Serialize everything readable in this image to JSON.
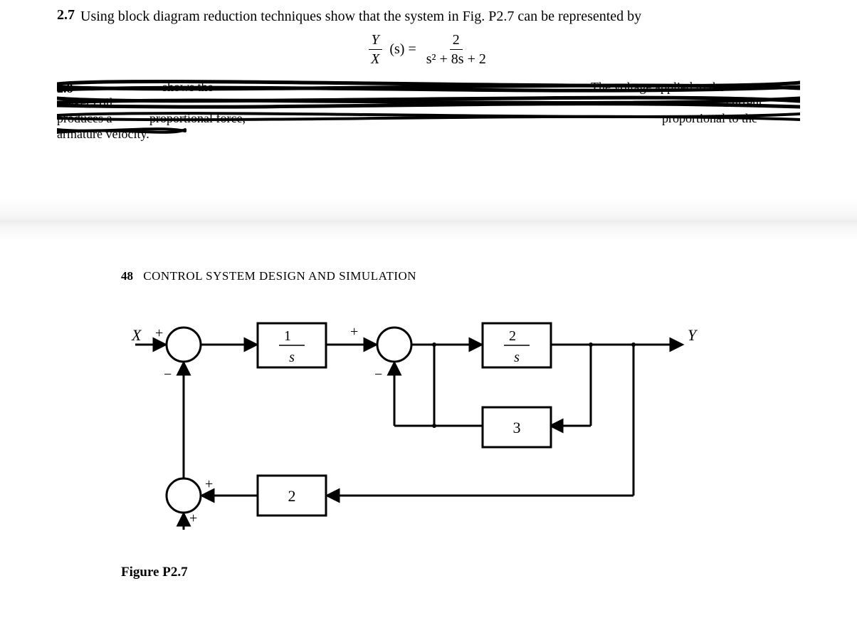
{
  "problem": {
    "number": "2.7",
    "text": "Using block diagram reduction techniques show that the system in Fig. P2.7 can be represented by"
  },
  "equation": {
    "lhs_num": "Y",
    "lhs_den": "X",
    "arg": "(s) =",
    "rhs_num": "2",
    "rhs_den": "s² + 8s + 2"
  },
  "crossed_out": {
    "next_num": "2.8",
    "fragments": [
      "shows the",
      "The voltage applied to the",
      "shaker coil",
      "current",
      "proportional force,",
      "proportional to the",
      "armature velocity.",
      "produces a"
    ]
  },
  "running_head": {
    "page_number": "48",
    "title": "CONTROL SYSTEM DESIGN AND SIMULATION"
  },
  "diagram": {
    "input_label": "X",
    "output_label": "Y",
    "sum1": {
      "top_sign": "+",
      "bottom_sign": "−"
    },
    "sum2": {
      "top_sign": "+",
      "bottom_sign": "−"
    },
    "sum3": {
      "right_sign": "+",
      "bottom_sign": "+"
    },
    "block_g1": {
      "num": "1",
      "den": "s"
    },
    "block_g2": {
      "num": "2",
      "den": "s"
    },
    "block_h1": "3",
    "block_h2": "2"
  },
  "figure_caption": "Figure P2.7"
}
